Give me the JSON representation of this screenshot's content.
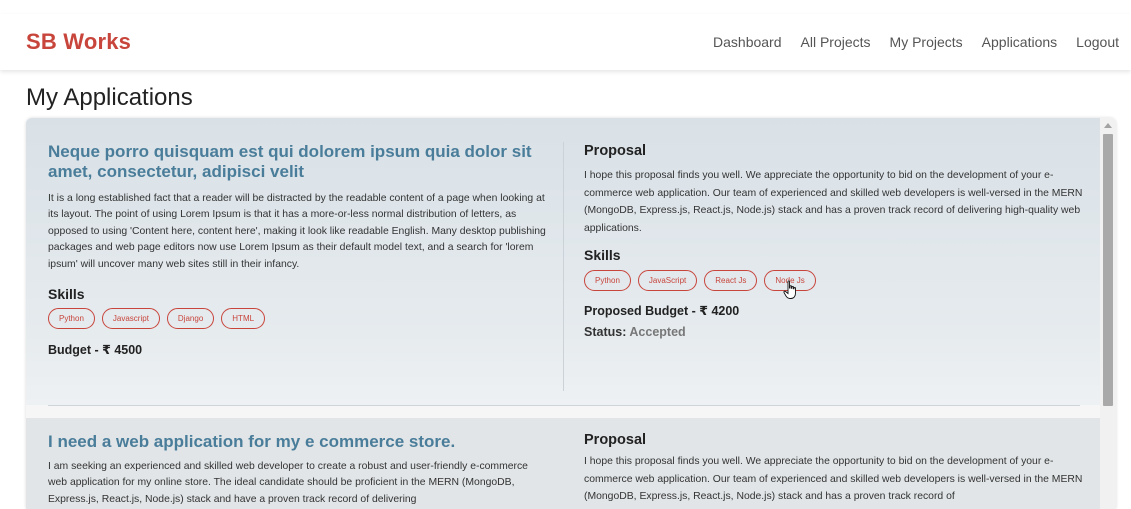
{
  "nav": {
    "brand": "SB Works",
    "links": [
      "Dashboard",
      "All Projects",
      "My Projects",
      "Applications",
      "Logout"
    ]
  },
  "page": {
    "title": "My Applications"
  },
  "applications": [
    {
      "project_title": "Neque porro quisquam est qui dolorem ipsum quia dolor sit amet, consectetur, adipisci velit",
      "project_description": "It is a long established fact that a reader will be distracted by the readable content of a page when looking at its layout. The point of using Lorem Ipsum is that it has a more-or-less normal distribution of letters, as opposed to using 'Content here, content here', making it look like readable English. Many desktop publishing packages and web page editors now use Lorem Ipsum as their default model text, and a search for 'lorem ipsum' will uncover many web sites still in their infancy.",
      "skills_label": "Skills",
      "skills": [
        "Python",
        "Javascript",
        "Django",
        "HTML"
      ],
      "budget": "Budget - ₹ 4500",
      "proposal_label": "Proposal",
      "proposal_text": "I hope this proposal finds you well. We appreciate the opportunity to bid on the development of your e-commerce web application. Our team of experienced and skilled web developers is well-versed in the MERN (MongoDB, Express.js, React.js, Node.js) stack and has a proven track record of delivering high-quality web applications.",
      "proposal_skills_label": "Skills",
      "proposal_skills": [
        "Python",
        "JavaScript",
        "React Js",
        "Node Js"
      ],
      "proposed_budget": "Proposed Budget - ₹ 4200",
      "status_label": "Status:",
      "status_value": "Accepted"
    },
    {
      "project_title": "I need a web application for my e commerce store.",
      "project_description": "I am seeking an experienced and skilled web developer to create a robust and user-friendly e-commerce web application for my online store. The ideal candidate should be proficient in the MERN (MongoDB, Express.js, React.js, Node.js) stack and have a proven track record of delivering",
      "proposal_label": "Proposal",
      "proposal_text": "I hope this proposal finds you well. We appreciate the opportunity to bid on the development of your e-commerce web application. Our team of experienced and skilled web developers is well-versed in the MERN (MongoDB, Express.js, React.js, Node.js) stack and has a proven track record of"
    }
  ],
  "colors": {
    "brand": "#c8453c",
    "project_title": "#4a7d9a",
    "chip": "#c8453c"
  }
}
